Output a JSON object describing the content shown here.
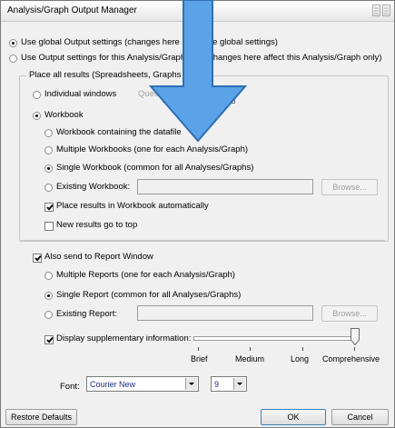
{
  "window": {
    "title": "Analysis/Graph Output Manager"
  },
  "scope": {
    "global": "Use global Output settings (changes here affect the global settings)",
    "local": "Use Output settings for this Analysis/Graph only (changes here affect this Analysis/Graph only)"
  },
  "placement": {
    "group_caption": "Place all results (Spreadsheets, Graphs",
    "individual_windows": "Individual windows",
    "queue_label": "Queue",
    "workbook": "Workbook",
    "wb_containing_datafile": "Workbook containing the datafile",
    "wb_multiple": "Multiple Workbooks (one for each Analysis/Graph)",
    "wb_single": "Single Workbook (common for all Analyses/Graphs)",
    "wb_existing": "Existing Workbook:",
    "browse": "Browse...",
    "place_auto": "Place results in Workbook automatically",
    "new_results_top": "New results go to top"
  },
  "report": {
    "also_send": "Also send to Report Window",
    "multiple": "Multiple Reports (one for each Analysis/Graph)",
    "single": "Single Report (common for all Analyses/Graphs)",
    "existing": "Existing Report:",
    "browse": "Browse...",
    "supplementary": "Display supplementary information:",
    "levels": [
      "Brief",
      "Medium",
      "Long",
      "Comprehensive"
    ],
    "level_value": 1.0
  },
  "font": {
    "label": "Font:",
    "family": "Courier New",
    "size": "9"
  },
  "footer": {
    "restore": "Restore Defaults",
    "ok": "OK",
    "cancel": "Cancel"
  },
  "colors": {
    "overlay_arrow": "#5aa3e8",
    "overlay_arrow_border": "#2f6fb5"
  }
}
